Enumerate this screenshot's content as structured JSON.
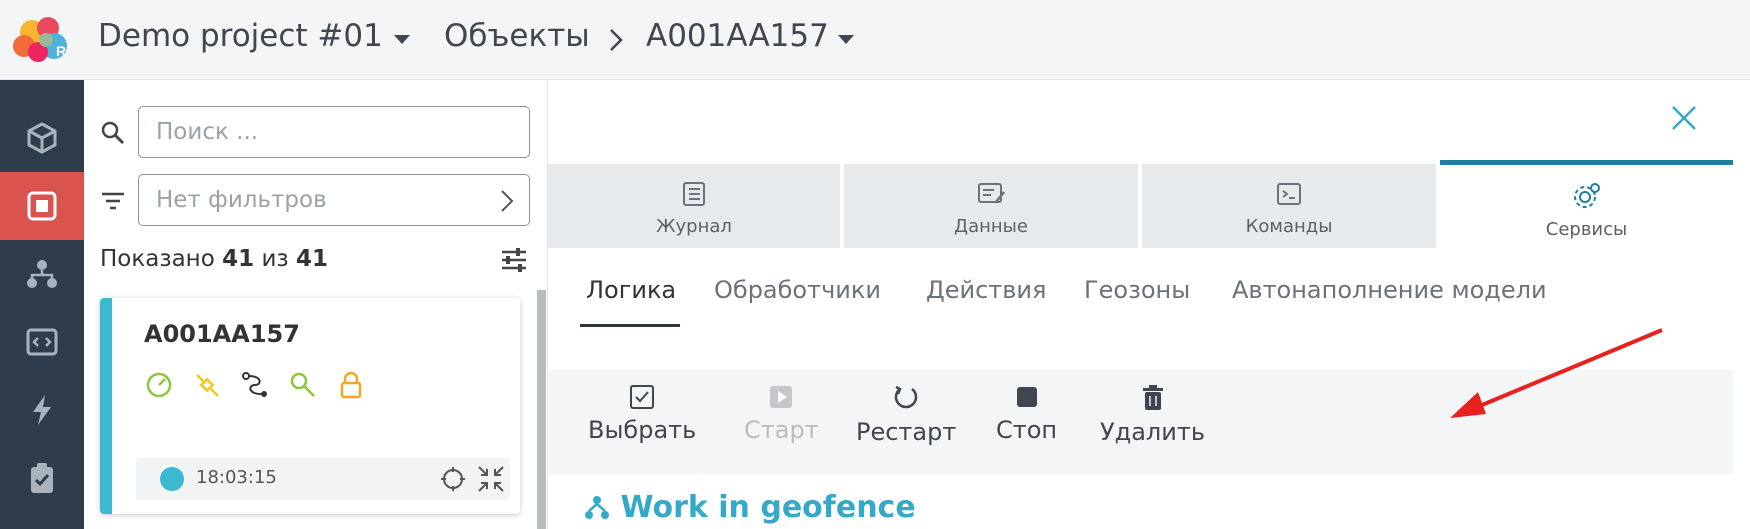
{
  "header": {
    "project_name": "Demo project #01",
    "breadcrumb_section": "Объекты",
    "current_object": "A001AA157"
  },
  "sidebar": {
    "items": [
      {
        "name": "objects-icon",
        "active": false
      },
      {
        "name": "monitoring-icon",
        "active": true
      },
      {
        "name": "hierarchy-icon",
        "active": false
      },
      {
        "name": "code-icon",
        "active": false
      },
      {
        "name": "lightning-icon",
        "active": false
      },
      {
        "name": "clipboard-icon",
        "active": false
      }
    ]
  },
  "panel": {
    "search_placeholder": "Поиск ...",
    "filter_text": "Нет фильтров",
    "shown_prefix": "Показано",
    "shown_count": "41",
    "shown_of": "из",
    "shown_total": "41",
    "card": {
      "title": "A001AA157",
      "time": "18:03:15"
    }
  },
  "main": {
    "tabs": [
      {
        "label": "Журнал",
        "icon": "journal-icon",
        "active": false
      },
      {
        "label": "Данные",
        "icon": "data-icon",
        "active": false
      },
      {
        "label": "Команды",
        "icon": "commands-icon",
        "active": false
      },
      {
        "label": "Сервисы",
        "icon": "services-icon",
        "active": true
      }
    ],
    "subtabs": [
      {
        "label": "Логика",
        "active": true
      },
      {
        "label": "Обработчики",
        "active": false
      },
      {
        "label": "Действия",
        "active": false
      },
      {
        "label": "Геозоны",
        "active": false
      },
      {
        "label": "Автонаполнение модели",
        "active": false
      }
    ],
    "toolbar": {
      "select": "Выбрать",
      "start": "Старт",
      "restart": "Рестарт",
      "stop": "Стоп",
      "delete": "Удалить"
    },
    "section_title": "Work in geofence"
  },
  "colors": {
    "accent": "#3cb9d1",
    "active_rail": "#d9534f",
    "rail_bg": "#2f3c4b",
    "annotation_arrow": "#e8201e"
  }
}
